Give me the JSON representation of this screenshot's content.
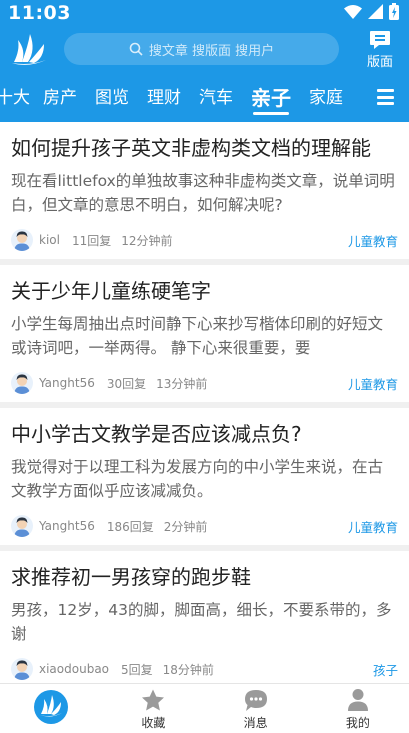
{
  "status_bar": {
    "time": "11:03"
  },
  "header": {
    "search_placeholder": "搜文章 搜版面 搜用户",
    "banmian_label": "版面"
  },
  "tabs": [
    {
      "label": "十大",
      "active": false
    },
    {
      "label": "房产",
      "active": false
    },
    {
      "label": "图览",
      "active": false
    },
    {
      "label": "理财",
      "active": false
    },
    {
      "label": "汽车",
      "active": false
    },
    {
      "label": "亲子",
      "active": true
    },
    {
      "label": "家庭",
      "active": false
    }
  ],
  "articles": [
    {
      "title": "如何提升孩子英文非虚构类文档的理解能",
      "snippet": "现在看littlefox的单独故事这种非虚构类文章，说单词明白，但文章的意思不明白，如何解决呢?",
      "author": "kiol",
      "replies": "11回复",
      "time": "12分钟前",
      "category": "儿童教育"
    },
    {
      "title": "关于少年儿童练硬笔字",
      "snippet": "小学生每周抽出点时间静下心来抄写楷体印刷的好短文或诗词吧，一举两得。 静下心来很重要，要",
      "author": "Yanght56",
      "replies": "30回复",
      "time": "13分钟前",
      "category": "儿童教育"
    },
    {
      "title": "中小学古文教学是否应该减点负?",
      "snippet": "我觉得对于以理工科为发展方向的中小学生来说，在古文教学方面似乎应该减减负。",
      "author": "Yanght56",
      "replies": "186回复",
      "time": "2分钟前",
      "category": "儿童教育"
    },
    {
      "title": "求推荐初一男孩穿的跑步鞋",
      "snippet": "男孩，12岁，43的脚，脚面高，细长，不要系带的，多谢",
      "author": "xiaodoubao",
      "replies": "5回复",
      "time": "18分钟前",
      "category": "孩子"
    }
  ],
  "bottom_nav": [
    {
      "label": "",
      "icon": "app-logo-icon"
    },
    {
      "label": "收藏",
      "icon": "star-icon"
    },
    {
      "label": "消息",
      "icon": "message-icon"
    },
    {
      "label": "我的",
      "icon": "person-icon"
    }
  ],
  "colors": {
    "brand": "#1d98e6",
    "category": "#1d98e6",
    "background": "#f0f0f0"
  }
}
